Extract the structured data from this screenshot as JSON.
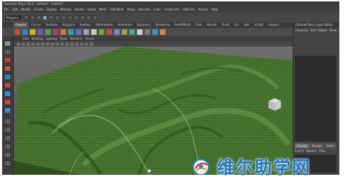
{
  "window": {
    "title": "Autodesk Maya 2013 - untitled* - untitled*"
  },
  "menubar": {
    "items": [
      "File",
      "Edit",
      "Modify",
      "Create",
      "Display",
      "Window",
      "Assets",
      "Select",
      "Mesh",
      "Edit Mesh",
      "Proxy",
      "Normals",
      "Color",
      "Create UVs",
      "Edit UVs",
      "Muscle",
      "Help"
    ]
  },
  "toolbar": {
    "mode_value": "Polygons"
  },
  "shelf": {
    "tabs": [
      "General",
      "Curves",
      "Surfaces",
      "Polygons",
      "Subdivs",
      "Deformation",
      "Animation",
      "Dynamics",
      "Rendering",
      "PaintEffects",
      "Toon",
      "Muscle",
      "Fluids",
      "Fur",
      "Hair",
      "nCloth",
      "Custom"
    ],
    "active_tab": "General",
    "icon_colors": [
      "#c8502a",
      "#2f88c8",
      "#d7b02e",
      "#7e56b0",
      "#3fa84a",
      "#b03a6a",
      "#d07b2a",
      "#2aa7a0",
      "#5a6fd0",
      "#a0a0a0",
      "#c8c8c8",
      "#6aaa34",
      "#cc4444",
      "#7788cc",
      "#aa9944",
      "#44aa88",
      "#d0d0d0",
      "#887766",
      "#3a8fd0",
      "#cc8844"
    ]
  },
  "viewport": {
    "panel_menu": [
      "View",
      "Shading",
      "Lighting",
      "Show",
      "Renderer",
      "Panels"
    ],
    "colors": {
      "sky_top": "#6f6f6f",
      "sky_bottom": "#4b4b4b",
      "terrain": "#3f6a2a",
      "terrain_light": "#5b8a3d",
      "terrain_dark": "#2a4a1c"
    },
    "viewcube_icon": "viewcube-icon",
    "cursor_icon": "arrow-cursor-icon"
  },
  "channel_box": {
    "title": "Channel Box / Layer Editor",
    "menu": [
      "Channels",
      "Edit",
      "Object",
      "Show"
    ],
    "layer_tabs": [
      "Display",
      "Render",
      "Anim"
    ],
    "layer_menu": [
      "Layers",
      "Options",
      "Help"
    ]
  },
  "watermark": {
    "text": "维尔助学网"
  }
}
